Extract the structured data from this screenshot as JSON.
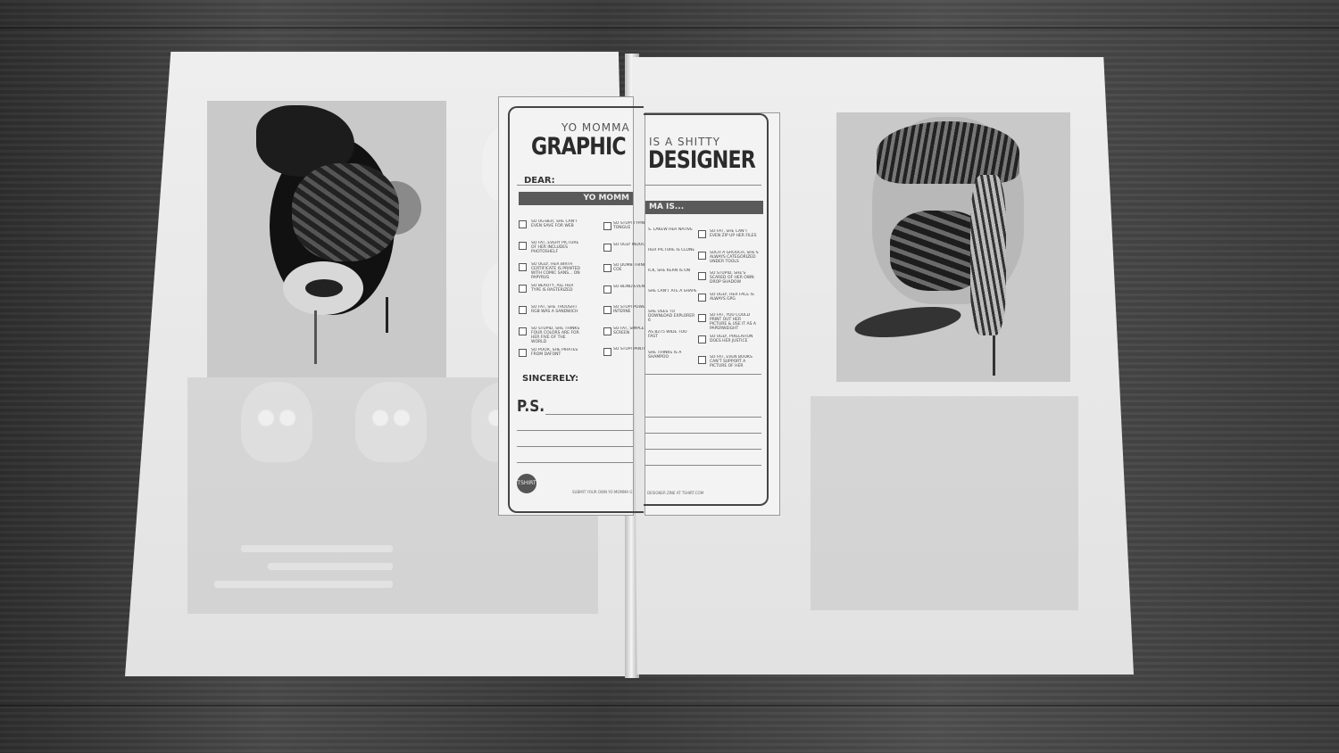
{
  "photo_description_excluded": true,
  "magazine": {
    "form": {
      "header_left_small": "YO MOMMA",
      "header_right_small": "IS A SHITTY",
      "title_left": "GRAPHIC",
      "title_right": "DESIGNER",
      "dear_label": "DEAR:",
      "bar_left": "YO MOMM",
      "bar_right": "MA IS...",
      "sincerely_label": "SINCERELY:",
      "ps_label": "P.S.",
      "logo_text": "TSHIRT",
      "footer_left": "SUBMIT YOUR OWN YO MOMMA G",
      "footer_right": "DESIGNER ZINE AT TSHIRT.COM",
      "col1_items": [
        "SO UG-BER, SHE CAN'T EVEN SAVE FOR WEB",
        "SO FAT, EVERY PICTURE OF HER INCLUDES PHOTOSHELF",
        "SO UGLY, HER BIRTH CERTIFICATE IS PRINTED WITH COMIC SANS... ON PAPYRUS",
        "SO BEAUTY, ALL HER TYPE IS RASTERIZED",
        "SO FAT, SHE THOUGHT RGB WAS A SANDWICH",
        "SO STUPID, SHE THINKS FOUR COLORS ARE FOR HER FIVE OF THE WORLD",
        "SO POOR, SHE PIRATES FROM DAFONT"
      ],
      "col2_items": [
        "SO STUPI TYPING TONGUE",
        "SO UGLY INDOOR TH",
        "SO DUMB THINKS THE COE",
        "SO BLIND EVEN CH",
        "SO STUPI POWERS INTERNE",
        "SO FAT, SIMPLES SCREEN",
        "SO STUPI PANTONE"
      ],
      "col3_items": [
        "S. LAKEW HER NATIVE",
        "HER PICTURE IS CLONE",
        "ICK, SHE KERN IS ON",
        "SHE CAN'T ATE A SHAPE",
        "SHE USES TO DOWNLOAD EXPLORER 6",
        "AS 8275 WIDE TOO FAST",
        "SHE THINKS IS A SHAMPOO"
      ],
      "col4_items": [
        "SO FAT, SHE CAN'T EVEN ZIP UP HER FILES",
        "SUCH A GROUCH, SHE'S ALWAYS CATEGORIZED UNDER TOOLS",
        "SO STUPID, SHE'S SCARED OF HER OWN DROP SHADOW",
        "SO UGLY, HER FACE IS ALWAYS GPG",
        "SO FAT, YOU COULD PRINT OUT HER PICTURE & USE IT AS A PAPERWEIGHT",
        "SO UGLY, PIXELATION DOES HER JUSTICE",
        "SO FAT, EVEN BOOKS CAN'T SUPPORT A PICTURE OF HER"
      ]
    }
  }
}
